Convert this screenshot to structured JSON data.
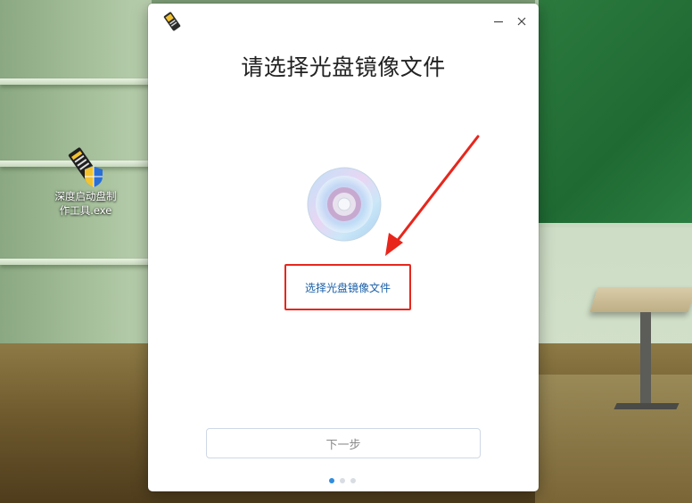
{
  "desktop": {
    "icon_label": "深度启动盘制\n作工具.exe",
    "icon_name": "usb-drive-icon"
  },
  "window": {
    "app_icon": "usb-drive-icon",
    "minimize_icon": "minimize-icon",
    "close_icon": "close-icon",
    "title": "请选择光盘镜像文件",
    "select_link": "选择光盘镜像文件",
    "disc_icon": "optical-disc-icon",
    "next_button": "下一步",
    "pager": {
      "total": 3,
      "active_index": 0
    }
  },
  "annotation": {
    "highlight_color": "#e8261c",
    "arrow_color": "#e8261c"
  },
  "colors": {
    "link": "#1a5fa8",
    "pager_active": "#2f8dde",
    "pager_inactive": "#d9dde3"
  }
}
